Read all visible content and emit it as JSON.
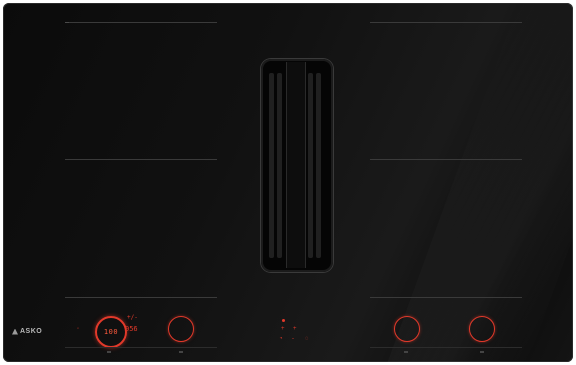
{
  "product": {
    "brand": "ASKO",
    "type": "induction cooktop with integrated downdraft extractor"
  },
  "controls": {
    "timer_value": "100",
    "timer_readout": "056",
    "timer_top_icons": "+/-",
    "center_icons": [
      "+",
      "+",
      "-"
    ],
    "colors": {
      "accent": "#e2392a",
      "surface": "#111111",
      "outline": "#3a3a3a"
    }
  },
  "icons": [
    "vent-grille-icon",
    "power-icon",
    "plus-icon",
    "minus-icon",
    "fan-icon",
    "timer-icon"
  ]
}
